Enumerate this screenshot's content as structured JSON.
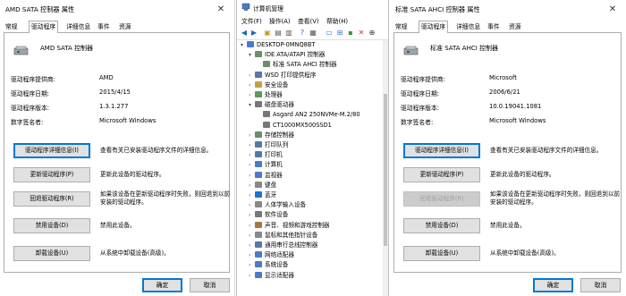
{
  "left": {
    "title": "AMD SATA 控制器 属性",
    "tabs": [
      "常规",
      "驱动程序",
      "详细信息",
      "事件",
      "资源"
    ],
    "active_tab": 1,
    "device_name": "AMD SATA 控制器",
    "props": [
      {
        "label": "驱动程序提供商:",
        "value": "AMD"
      },
      {
        "label": "驱动程序日期:",
        "value": "2015/4/15"
      },
      {
        "label": "驱动程序版本:",
        "value": "1.3.1.277"
      },
      {
        "label": "数字签名者:",
        "value": "Microsoft Windows"
      }
    ],
    "buttons": [
      {
        "label": "驱动程序详细信息(I)",
        "desc": "查看有关已安装驱动程序文件的详细信息。",
        "disabled": false,
        "focus": true
      },
      {
        "label": "更新驱动程序(P)",
        "desc": "更新此设备的驱动程序。",
        "disabled": false,
        "focus": false
      },
      {
        "label": "回退驱动程序(R)",
        "desc": "如果该设备在更新驱动程序时失败，则回退到以前安装的驱动程序。",
        "disabled": false,
        "focus": false
      },
      {
        "label": "禁用设备(D)",
        "desc": "禁用此设备。",
        "disabled": false,
        "focus": false
      },
      {
        "label": "卸载设备(U)",
        "desc": "从系统中卸载设备(高级)。",
        "disabled": false,
        "focus": false
      }
    ],
    "ok": "确定",
    "cancel": "取消"
  },
  "middle": {
    "title": "计算机管理",
    "menus": [
      "文件(F)",
      "操作(A)",
      "查看(V)",
      "帮助(H)"
    ],
    "tree": [
      {
        "label": "DESKTOP-0MNQ8BT",
        "level": 0,
        "arrow": "▾",
        "icon": "#4a7bc8"
      },
      {
        "label": "IDE ATA/ATAPI 控制器",
        "level": 1,
        "arrow": "▾",
        "icon": "#6b8e6b"
      },
      {
        "label": "标准 SATA AHCI 控制器",
        "level": 2,
        "arrow": "",
        "icon": "#6b8e6b"
      },
      {
        "label": "WSD 打印提供程序",
        "level": 1,
        "arrow": "›",
        "icon": "#5577aa"
      },
      {
        "label": "安全设备",
        "level": 1,
        "arrow": "›",
        "icon": "#c8a040"
      },
      {
        "label": "处理器",
        "level": 1,
        "arrow": "›",
        "icon": "#5a9a5a"
      },
      {
        "label": "磁盘驱动器",
        "level": 1,
        "arrow": "▾",
        "icon": "#777777"
      },
      {
        "label": "Asgard AN2 250NVMe-M.2/80",
        "level": 2,
        "arrow": "",
        "icon": "#777777"
      },
      {
        "label": "CT1000MX500SSD1",
        "level": 2,
        "arrow": "",
        "icon": "#777777"
      },
      {
        "label": "存储控制器",
        "level": 1,
        "arrow": "›",
        "icon": "#6b8e6b"
      },
      {
        "label": "打印队列",
        "level": 1,
        "arrow": "›",
        "icon": "#5577aa"
      },
      {
        "label": "打印机",
        "level": 1,
        "arrow": "›",
        "icon": "#5577aa"
      },
      {
        "label": "计算机",
        "level": 1,
        "arrow": "›",
        "icon": "#4a7bc8"
      },
      {
        "label": "监视器",
        "level": 1,
        "arrow": "›",
        "icon": "#4a7bc8"
      },
      {
        "label": "键盘",
        "level": 1,
        "arrow": "›",
        "icon": "#888888"
      },
      {
        "label": "蓝牙",
        "level": 1,
        "arrow": "›",
        "icon": "#1e73d8"
      },
      {
        "label": "人体学输入设备",
        "level": 1,
        "arrow": "›",
        "icon": "#888888"
      },
      {
        "label": "软件设备",
        "level": 1,
        "arrow": "›",
        "icon": "#777777"
      },
      {
        "label": "声音、视频和游戏控制器",
        "level": 1,
        "arrow": "›",
        "icon": "#aa7744"
      },
      {
        "label": "鼠标和其他指针设备",
        "level": 1,
        "arrow": "›",
        "icon": "#888888"
      },
      {
        "label": "通用串行总线控制器",
        "level": 1,
        "arrow": "›",
        "icon": "#5577aa"
      },
      {
        "label": "网络适配器",
        "level": 1,
        "arrow": "›",
        "icon": "#4a7bc8"
      },
      {
        "label": "系统设备",
        "level": 1,
        "arrow": "›",
        "icon": "#4a7bc8"
      },
      {
        "label": "显示适配器",
        "level": 1,
        "arrow": "›",
        "icon": "#4a7bc8"
      }
    ]
  },
  "right": {
    "title": "标准 SATA AHCI 控制器 属性",
    "tabs": [
      "常规",
      "驱动程序",
      "详细信息",
      "事件",
      "资源"
    ],
    "active_tab": 1,
    "device_name": "标准 SATA AHCI 控制器",
    "props": [
      {
        "label": "驱动程序提供商:",
        "value": "Microsoft"
      },
      {
        "label": "驱动程序日期:",
        "value": "2006/6/21"
      },
      {
        "label": "驱动程序版本:",
        "value": "10.0.19041.1081"
      },
      {
        "label": "数字签名者:",
        "value": "Microsoft Windows"
      }
    ],
    "buttons": [
      {
        "label": "驱动程序详细信息(I)",
        "desc": "查看有关已安装驱动程序文件的详细信息。",
        "disabled": false,
        "focus": true
      },
      {
        "label": "更新驱动程序(P)",
        "desc": "更新此设备的驱动程序。",
        "disabled": false,
        "focus": false
      },
      {
        "label": "回退驱动程序(R)",
        "desc": "如果该设备在更新驱动程序时失败，则回退到以前安装的驱动程序。",
        "disabled": true,
        "focus": false
      },
      {
        "label": "禁用设备(D)",
        "desc": "禁用此设备。",
        "disabled": false,
        "focus": false
      },
      {
        "label": "卸载设备(U)",
        "desc": "从系统中卸载设备(高级)。",
        "disabled": false,
        "focus": false
      }
    ],
    "ok": "确定",
    "cancel": "取消"
  }
}
